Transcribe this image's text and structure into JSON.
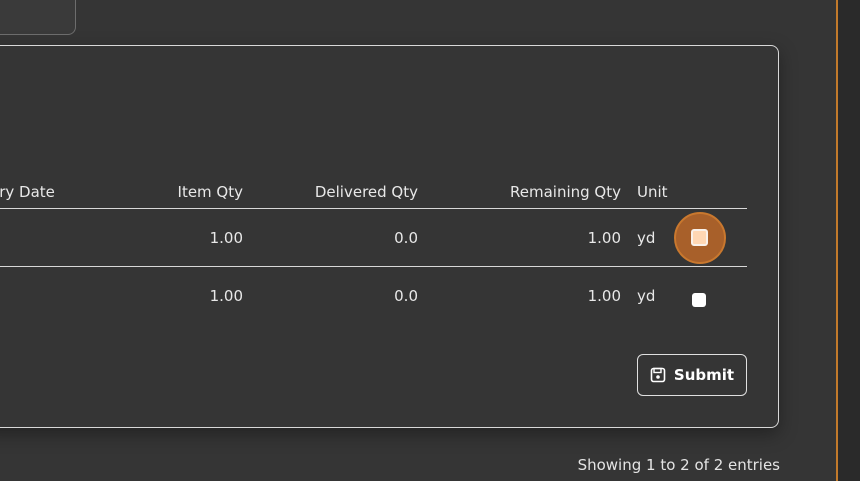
{
  "table": {
    "headers": {
      "delivery_date": "ery Date",
      "item_qty": "Item Qty",
      "delivered_qty": "Delivered Qty",
      "remaining_qty": "Remaining Qty",
      "unit": "Unit"
    },
    "rows": [
      {
        "item_qty": "1.00",
        "delivered_qty": "0.0",
        "remaining_qty": "1.00",
        "unit": "yd",
        "checked": false,
        "focused": true
      },
      {
        "item_qty": "1.00",
        "delivered_qty": "0.0",
        "remaining_qty": "1.00",
        "unit": "yd",
        "checked": false,
        "focused": false
      }
    ]
  },
  "actions": {
    "submit_label": "Submit",
    "submit_icon": "save-icon"
  },
  "footer": {
    "entries_text": "Showing 1 to 2 of 2 entries"
  },
  "colors": {
    "background": "#353535",
    "focus_accent": "#c9782e",
    "checkbox_focused": "#ffd7b3",
    "border": "#d8d8d8"
  }
}
